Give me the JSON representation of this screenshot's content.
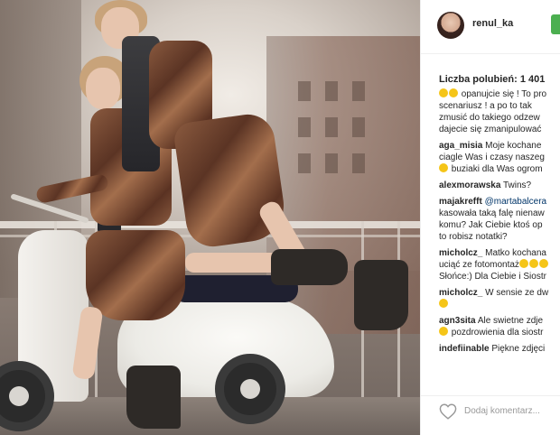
{
  "post": {
    "username": "renul_ka",
    "likes_label": "Liczba polubień: 1 401",
    "add_comment_placeholder": "Dodaj komentarz..."
  },
  "comments": [
    {
      "user": "",
      "lines": [
        "opanujcie się ! To pro",
        "scenariusz ! a po to tak",
        "zmusić do takiego odzew",
        "dajecie się zmanipulować"
      ],
      "emoji_before": 2
    },
    {
      "user": "aga_misia",
      "lines": [
        "Moje kochane",
        "ciagle Was i czasy naszeg",
        "buziaki dla Was ogrom"
      ],
      "emoji_last": 1
    },
    {
      "user": "alexmorawska",
      "lines": [
        "Twins?"
      ]
    },
    {
      "user": "majakrefft",
      "mention": "@martabalcera",
      "lines": [
        "kasowała taką falę nienaw",
        "komu? Jak Ciebie ktoś op",
        "to robisz notatki?"
      ]
    },
    {
      "user": "micholcz_",
      "lines": [
        "Matko kochana",
        "uciąć ze fotomontaż",
        "Słońce:) Dla Ciebie i Siostr"
      ]
    },
    {
      "user": "micholcz_",
      "lines": [
        "W sensie ze dw"
      ],
      "emoji_last": 1
    },
    {
      "user": "agn3sita",
      "lines": [
        "Ale swietne zdje",
        "pozdrowienia dla siostr"
      ]
    },
    {
      "user": "indefiinable",
      "lines": [
        "Piękne zdjęci"
      ]
    }
  ],
  "colors": {
    "follow_button": "#4caf50",
    "text": "#262626",
    "mention": "#003569",
    "placeholder": "#999999"
  },
  "icons": {
    "like": "heart-icon",
    "avatar": "profile-avatar"
  }
}
